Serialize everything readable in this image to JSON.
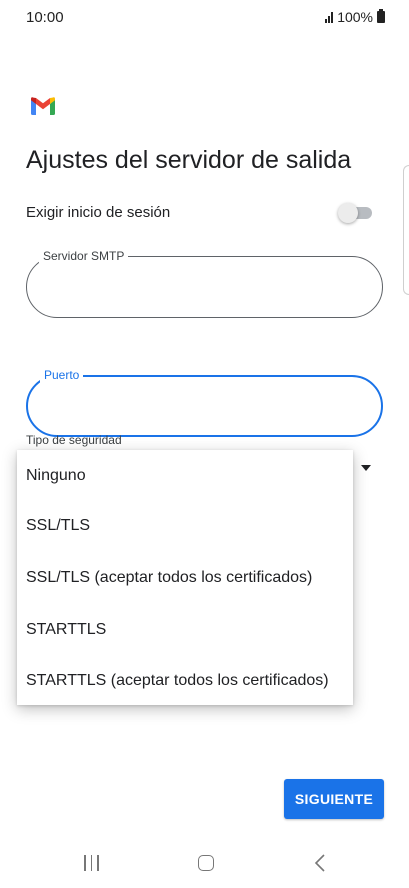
{
  "status_bar": {
    "time": "10:00",
    "battery": "100%"
  },
  "app": {
    "logo": "gmail-logo",
    "title": "Ajustes del servidor de salida"
  },
  "login_toggle": {
    "label": "Exigir inicio de sesión",
    "enabled": false
  },
  "smtp_field": {
    "label": "Servidor SMTP",
    "value": ""
  },
  "port_field": {
    "label": "Puerto",
    "value": "",
    "focused": true
  },
  "security": {
    "label": "Tipo de seguridad",
    "options": [
      "Ninguno",
      "SSL/TLS",
      "SSL/TLS (aceptar todos los certificados)",
      "STARTTLS",
      "STARTTLS (aceptar todos los certificados)"
    ]
  },
  "next_button": {
    "label": "SIGUIENTE"
  },
  "colors": {
    "accent": "#1a73e8",
    "text": "#202124"
  },
  "nav_bar": {
    "icons": [
      "recent-apps-icon",
      "home-icon",
      "back-icon"
    ]
  }
}
